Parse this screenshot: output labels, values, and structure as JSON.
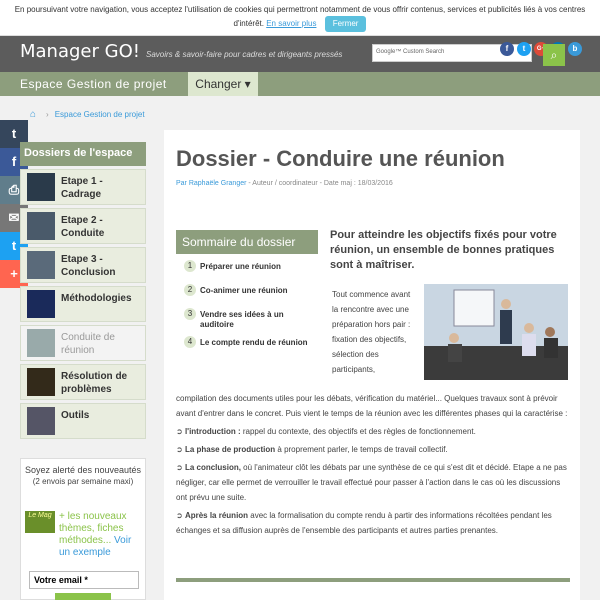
{
  "cookie": {
    "text": "En poursuivant votre navigation, vous acceptez l'utilisation de cookies qui permettront notamment de vous offrir contenus, services et publicités liés à vos centres d'intérêt.",
    "link": "En savoir plus",
    "button": "Fermer"
  },
  "header": {
    "logo": "Manager GO!",
    "tagline": "Savoirs & savoir-faire pour cadres et dirigeants pressés",
    "search_placeholder": "Google™ Custom Search",
    "social": [
      "f",
      "t",
      "G+",
      "in",
      "b"
    ]
  },
  "section": {
    "title": "Espace Gestion de projet",
    "change": "Changer ▾"
  },
  "breadcrumb": {
    "item": "Espace Gestion de projet"
  },
  "share": [
    "t",
    "f",
    "⎙",
    "✉",
    "t",
    "+"
  ],
  "sidebar": {
    "heading": "Dossiers de l'espace",
    "items": [
      {
        "label": "Etape 1 - Cadrage"
      },
      {
        "label": "Etape 2 - Conduite"
      },
      {
        "label": "Etape 3 - Conclusion"
      },
      {
        "label": "Méthodologies"
      },
      {
        "label": "Conduite de réunion"
      },
      {
        "label": "Résolution de problèmes"
      },
      {
        "label": "Outils"
      }
    ]
  },
  "alert": {
    "title": "Soyez alerté des nouveautés",
    "sub": "(2 envois par semaine maxi)",
    "lemag": "Le Mag",
    "text": "+ les nouveaux thèmes, fiches méthodes...",
    "link": "Voir un exemple",
    "input_value": "Votre email *"
  },
  "article": {
    "title": "Dossier - Conduire une réunion",
    "author": "Par Raphaële Granger",
    "meta": "- Auteur / coordinateur - Date maj : 18/03/2016",
    "lead": "Pour atteindre les objectifs fixés pour votre réunion, un ensemble de bonnes pratiques sont à maîtriser.",
    "p1": "Tout commence avant la rencontre avec une préparation hors pair : fixation des objectifs, sélection des participants,",
    "p2": "compilation des documents utiles pour les débats, vérification du matériel... Quelques travaux sont à prévoir avant d'entrer dans le concret. Puis vient le temps de la réunion avec les différentes phases qui la caractérise :",
    "b1_strong": "l'introduction :",
    "b1": " rappel du contexte, des objectifs et des règles de fonctionnement.",
    "b2_strong": "La phase de production",
    "b2": " à proprement parler, le temps de travail collectif.",
    "b3_strong": "La conclusion,",
    "b3": " où l'animateur clôt les débats par une synthèse de ce qui s'est dit et décidé. Etape a ne pas négliger, car elle permet de verrouiller le travail effectué pour passer à l'action dans le cas où les discussions ont prévu une suite.",
    "b4_strong": "Après la réunion",
    "b4": " avec la formalisation du compte rendu à partir des informations récoltées pendant les échanges et sa diffusion auprès de l'ensemble des participants et autres parties prenantes."
  },
  "summary": {
    "head": "Sommaire du dossier",
    "items": [
      {
        "n": "1",
        "label": "Préparer une réunion"
      },
      {
        "n": "2",
        "label": "Co-animer une réunion"
      },
      {
        "n": "3",
        "label": "Vendre ses idées à un auditoire"
      },
      {
        "n": "4",
        "label": "Le compte rendu de réunion"
      }
    ]
  },
  "colors": {
    "accent": "#8d9e7d",
    "link": "#3a9ad9",
    "green": "#8bc34a"
  }
}
